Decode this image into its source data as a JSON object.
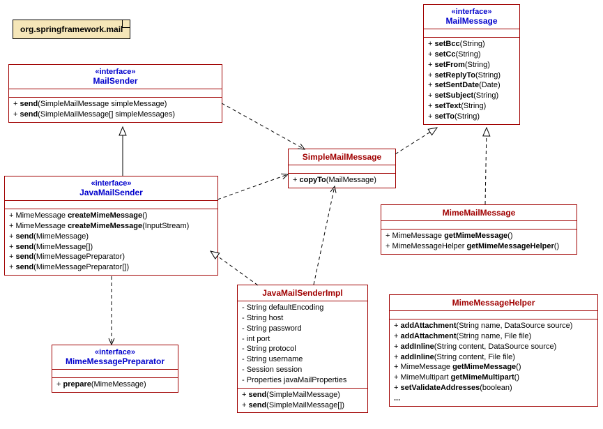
{
  "note": {
    "text": "org.springframework.mail"
  },
  "classes": {
    "MailSender": {
      "stereotype": "«interface»",
      "name": "MailSender",
      "attrs": [],
      "ops": [
        {
          "vis": "+",
          "name": "send",
          "params": "(SimpleMailMessage simpleMessage)"
        },
        {
          "vis": "+",
          "name": "send",
          "params": "(SimpleMailMessage[] simpleMessages)"
        }
      ]
    },
    "MailMessage": {
      "stereotype": "«interface»",
      "name": "MailMessage",
      "attrs": [],
      "ops": [
        {
          "vis": "+",
          "name": "setBcc",
          "params": "(String)"
        },
        {
          "vis": "+",
          "name": "setCc",
          "params": "(String)"
        },
        {
          "vis": "+",
          "name": "setFrom",
          "params": "(String)"
        },
        {
          "vis": "+",
          "name": "setReplyTo",
          "params": "(String)"
        },
        {
          "vis": "+",
          "name": "setSentDate",
          "params": "(Date)"
        },
        {
          "vis": "+",
          "name": "setSubject",
          "params": "(String)"
        },
        {
          "vis": "+",
          "name": "setText",
          "params": "(String)"
        },
        {
          "vis": "+",
          "name": "setTo",
          "params": "(String)"
        }
      ]
    },
    "JavaMailSender": {
      "stereotype": "«interface»",
      "name": "JavaMailSender",
      "attrs": [],
      "ops": [
        {
          "vis": "+",
          "ret": "MimeMessage ",
          "name": "createMimeMessage",
          "params": "()"
        },
        {
          "vis": "+",
          "ret": "MimeMessage ",
          "name": "createMimeMessage",
          "params": "(InputStream)"
        },
        {
          "vis": "+",
          "name": "send",
          "params": "(MimeMessage)"
        },
        {
          "vis": "+",
          "name": "send",
          "params": "(MimeMessage[])"
        },
        {
          "vis": "+",
          "name": "send",
          "params": "(MimeMessagePreparator)"
        },
        {
          "vis": "+",
          "name": "send",
          "params": "(MimeMessagePreparator[])"
        }
      ]
    },
    "SimpleMailMessage": {
      "name": "SimpleMailMessage",
      "attrs": [],
      "ops": [
        {
          "vis": "+",
          "name": "copyTo",
          "params": "(MailMessage)"
        }
      ]
    },
    "MimeMailMessage": {
      "name": "MimeMailMessage",
      "attrs": [],
      "ops": [
        {
          "vis": "+",
          "ret": "MimeMessage ",
          "name": "getMimeMessage",
          "params": "()"
        },
        {
          "vis": "+",
          "ret": "MimeMessageHelper ",
          "name": "getMimeMessageHelper",
          "params": "()"
        }
      ]
    },
    "MimeMessagePreparator": {
      "stereotype": "«interface»",
      "name": "MimeMessagePreparator",
      "attrs": [],
      "ops": [
        {
          "vis": "+",
          "name": "prepare",
          "params": "(MimeMessage)"
        }
      ]
    },
    "JavaMailSenderImpl": {
      "name": "JavaMailSenderImpl",
      "attrs": [
        {
          "vis": "-",
          "text": "String defaultEncoding"
        },
        {
          "vis": "-",
          "text": "String host"
        },
        {
          "vis": "-",
          "text": "String password"
        },
        {
          "vis": "-",
          "text": "int port"
        },
        {
          "vis": "-",
          "text": "String protocol"
        },
        {
          "vis": "-",
          "text": "String username"
        },
        {
          "vis": "-",
          "text": "Session session"
        },
        {
          "vis": "-",
          "text": "Properties javaMailProperties"
        }
      ],
      "ops": [
        {
          "vis": "+",
          "name": "send",
          "params": "(SimpleMailMessage)"
        },
        {
          "vis": "+",
          "name": "send",
          "params": "(SimpleMailMessage[])"
        }
      ]
    },
    "MimeMessageHelper": {
      "name": "MimeMessageHelper",
      "attrs": [],
      "ops": [
        {
          "vis": "+",
          "name": "addAttachment",
          "params": "(String name, DataSource source)"
        },
        {
          "vis": "+",
          "name": "addAttachment",
          "params": "(String name, File file)"
        },
        {
          "vis": "+",
          "name": "addInline",
          "params": "(String content, DataSource source)"
        },
        {
          "vis": "+",
          "name": "addInline",
          "params": "(String content, File file)"
        },
        {
          "vis": "+",
          "ret": "MimeMessage ",
          "name": "getMimeMessage",
          "params": "()"
        },
        {
          "vis": "+",
          "ret": "MimeMultipart ",
          "name": "getMimeMultipart",
          "params": "()"
        },
        {
          "vis": "+",
          "name": "setValidateAddresses",
          "params": "(boolean)"
        },
        {
          "vis": "",
          "name": "...",
          "params": ""
        }
      ]
    }
  }
}
